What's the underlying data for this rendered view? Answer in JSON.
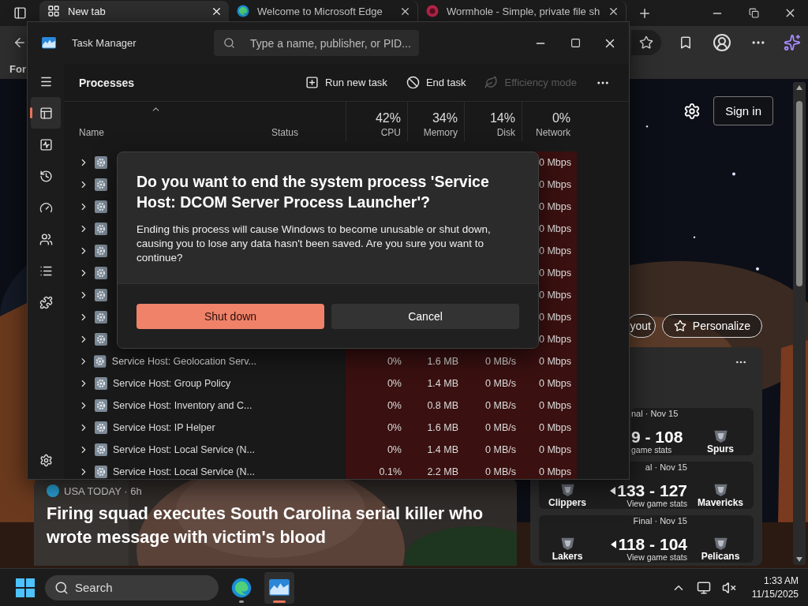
{
  "browser": {
    "tabs": [
      {
        "title": "New tab",
        "selected": true,
        "kind": "newtab"
      },
      {
        "title": "Welcome to Microsoft Edge",
        "selected": false,
        "kind": "edge"
      },
      {
        "title": "Wormhole - Simple, private file sh",
        "selected": false,
        "kind": "wormhole"
      }
    ],
    "favorites_bar": {
      "label": "For"
    },
    "page": {
      "sign_in": "Sign in",
      "buttons": [
        "yout",
        "Personalize"
      ],
      "games": [
        {
          "status": "nal · Nov 15",
          "score": "9 - 108",
          "link": "game stats",
          "right_team": "Spurs",
          "left_winner": false
        },
        {
          "status": "al · Nov 15",
          "left_team": "Clippers",
          "score": "133 - 127",
          "link": "View game stats",
          "right_team": "Mavericks",
          "left_winner": true
        },
        {
          "status": "Final · Nov 15",
          "left_team": "Lakers",
          "score": "118 - 104",
          "link": "View game stats",
          "right_team": "Pelicans",
          "left_winner": true
        }
      ],
      "news": {
        "meta": "USA TODAY · 6h",
        "headline": "Firing squad executes South Carolina serial killer who wrote message with victim's blood"
      }
    }
  },
  "task_manager": {
    "title": "Task Manager",
    "search_placeholder": "Type a name, publisher, or PID...",
    "nav": [
      {
        "kind": "menu",
        "selected": false
      },
      {
        "kind": "processes",
        "selected": true
      },
      {
        "kind": "performance",
        "selected": false
      },
      {
        "kind": "history",
        "selected": false
      },
      {
        "kind": "startup",
        "selected": false
      },
      {
        "kind": "users",
        "selected": false
      },
      {
        "kind": "details",
        "selected": false
      },
      {
        "kind": "services",
        "selected": false
      },
      {
        "kind": "settings",
        "selected": false
      }
    ],
    "page_title": "Processes",
    "actions": [
      {
        "label": "Run new task",
        "kind": "run",
        "disabled": false
      },
      {
        "label": "End task",
        "kind": "end",
        "disabled": false
      },
      {
        "label": "Efficiency mode",
        "kind": "efficiency",
        "disabled": true
      }
    ],
    "columns": [
      {
        "label": "Name"
      },
      {
        "label": "Status"
      },
      {
        "label": "CPU",
        "total": "42%"
      },
      {
        "label": "Memory",
        "total": "34%"
      },
      {
        "label": "Disk",
        "total": "14%"
      },
      {
        "label": "Network",
        "total": "0%"
      }
    ],
    "rows": [
      {
        "network": "0 Mbps"
      },
      {
        "network": "0 Mbps"
      },
      {
        "network": "0 Mbps"
      },
      {
        "network": "0 Mbps"
      },
      {
        "network": "0 Mbps"
      },
      {
        "network": "0 Mbps"
      },
      {
        "network": "0 Mbps"
      },
      {
        "network": "0 Mbps"
      },
      {
        "network": "0 Mbps"
      },
      {
        "name": "Service Host: Geolocation Serv...",
        "cpu": "0%",
        "memory": "1.6 MB",
        "disk": "0 MB/s",
        "network": "0 Mbps"
      },
      {
        "name": "Service Host: Group Policy",
        "cpu": "0%",
        "memory": "1.4 MB",
        "disk": "0 MB/s",
        "network": "0 Mbps"
      },
      {
        "name": "Service Host: Inventory and C...",
        "cpu": "0%",
        "memory": "0.8 MB",
        "disk": "0 MB/s",
        "network": "0 Mbps"
      },
      {
        "name": "Service Host: IP Helper",
        "cpu": "0%",
        "memory": "1.6 MB",
        "disk": "0 MB/s",
        "network": "0 Mbps"
      },
      {
        "name": "Service Host: Local Service (N...",
        "cpu": "0%",
        "memory": "1.4 MB",
        "disk": "0 MB/s",
        "network": "0 Mbps"
      },
      {
        "name": "Service Host: Local Service (N...",
        "cpu": "0.1%",
        "memory": "2.2 MB",
        "disk": "0 MB/s",
        "network": "0 Mbps"
      }
    ],
    "dialog": {
      "title": "Do you want to end the system process 'Service Host: DCOM Server Process Launcher'?",
      "message": "Ending this process will cause Windows to become unusable or shut down, causing you to lose any data hasn't been saved. Are you sure you want to continue?",
      "buttons": [
        {
          "label": "Shut down",
          "kind": "primary"
        },
        {
          "label": "Cancel",
          "kind": "secondary"
        }
      ]
    }
  },
  "taskbar": {
    "search": "Search",
    "time": "1:33 AM",
    "date": "11/15/2025",
    "apps": [
      {
        "kind": "edge",
        "active": false
      },
      {
        "kind": "taskmgr",
        "active": true
      }
    ]
  }
}
